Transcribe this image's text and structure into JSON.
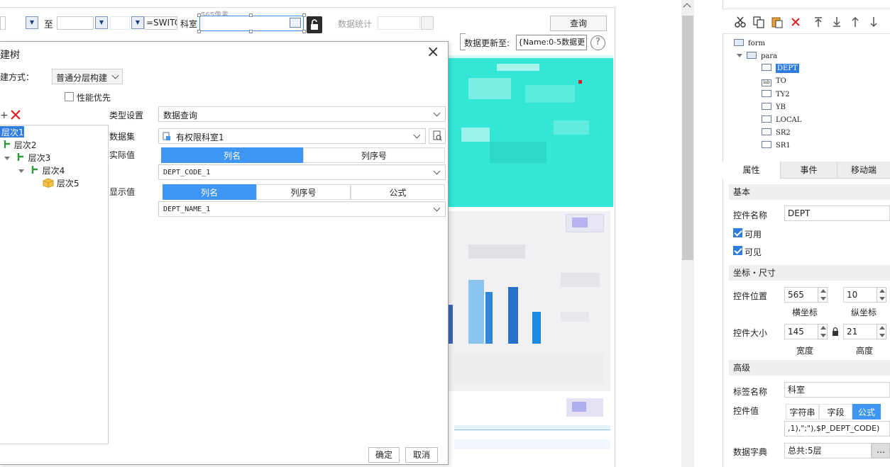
{
  "toolbar": {
    "to_label": "至",
    "switch_text": "=SWITC",
    "dept_label": "科室",
    "dim_hint": "565像素",
    "stats_placeholder": "数据统计",
    "query_button": "查询",
    "update_label": "数据更新至:",
    "update_value": "{Name:0-5数据更",
    "help": "?"
  },
  "dialog": {
    "title": "建树",
    "close": "×",
    "method_label": "建方式：",
    "method_value": "普通分层构建",
    "perf_label": "性能优先",
    "tree_items": [
      {
        "label": "层次1"
      },
      {
        "label": "层次2"
      },
      {
        "label": "层次3"
      },
      {
        "label": "层次4"
      },
      {
        "label": "层次5"
      }
    ],
    "type_label": "类型设置",
    "type_value": "数据查询",
    "dataset_label": "数据集",
    "dataset_value": "有权限科室1",
    "actual_label": "实际值",
    "actual_tabs": [
      "列名",
      "列序号"
    ],
    "actual_value": "DEPT_CODE_1",
    "display_label": "显示值",
    "display_tabs": [
      "列名",
      "列序号",
      "公式"
    ],
    "display_value": "DEPT_NAME_1",
    "ok_button": "确定",
    "cancel_button": "取消"
  },
  "right_panel": {
    "tree": [
      {
        "label": "form"
      },
      {
        "label": "para"
      },
      {
        "label": "DEPT"
      },
      {
        "label": "TO"
      },
      {
        "label": "TY2"
      },
      {
        "label": "YB"
      },
      {
        "label": "LOCAL"
      },
      {
        "label": "SR2"
      },
      {
        "label": "SR1"
      }
    ],
    "tabs": [
      "属性",
      "事件",
      "移动端"
    ],
    "section_basic": "基本",
    "name_label": "控件名称",
    "name_value": "DEPT",
    "enabled_label": "可用",
    "visible_label": "可见",
    "section_pos": "坐标・尺寸",
    "pos_label": "控件位置",
    "pos_x": "565",
    "pos_y": "10",
    "x_caption": "横坐标",
    "y_caption": "纵坐标",
    "size_label": "控件大小",
    "width": "145",
    "height": "21",
    "w_caption": "宽度",
    "h_caption": "高度",
    "section_adv": "高级",
    "tag_label": "标签名称",
    "tag_value": "科室",
    "value_label": "控件值",
    "value_tabs": [
      "字符串",
      "字段",
      "公式"
    ],
    "formula_value": ",1),\";\"),$P_DEPT_CODE)",
    "dict_label": "数据字典",
    "dict_value": "总共:5层",
    "dict_more": "…"
  },
  "colors": {
    "accent": "#3e95f2",
    "teal": "#33e6d6",
    "delete_red": "#e02020",
    "selected_tree_bg": "#2f7de1"
  }
}
